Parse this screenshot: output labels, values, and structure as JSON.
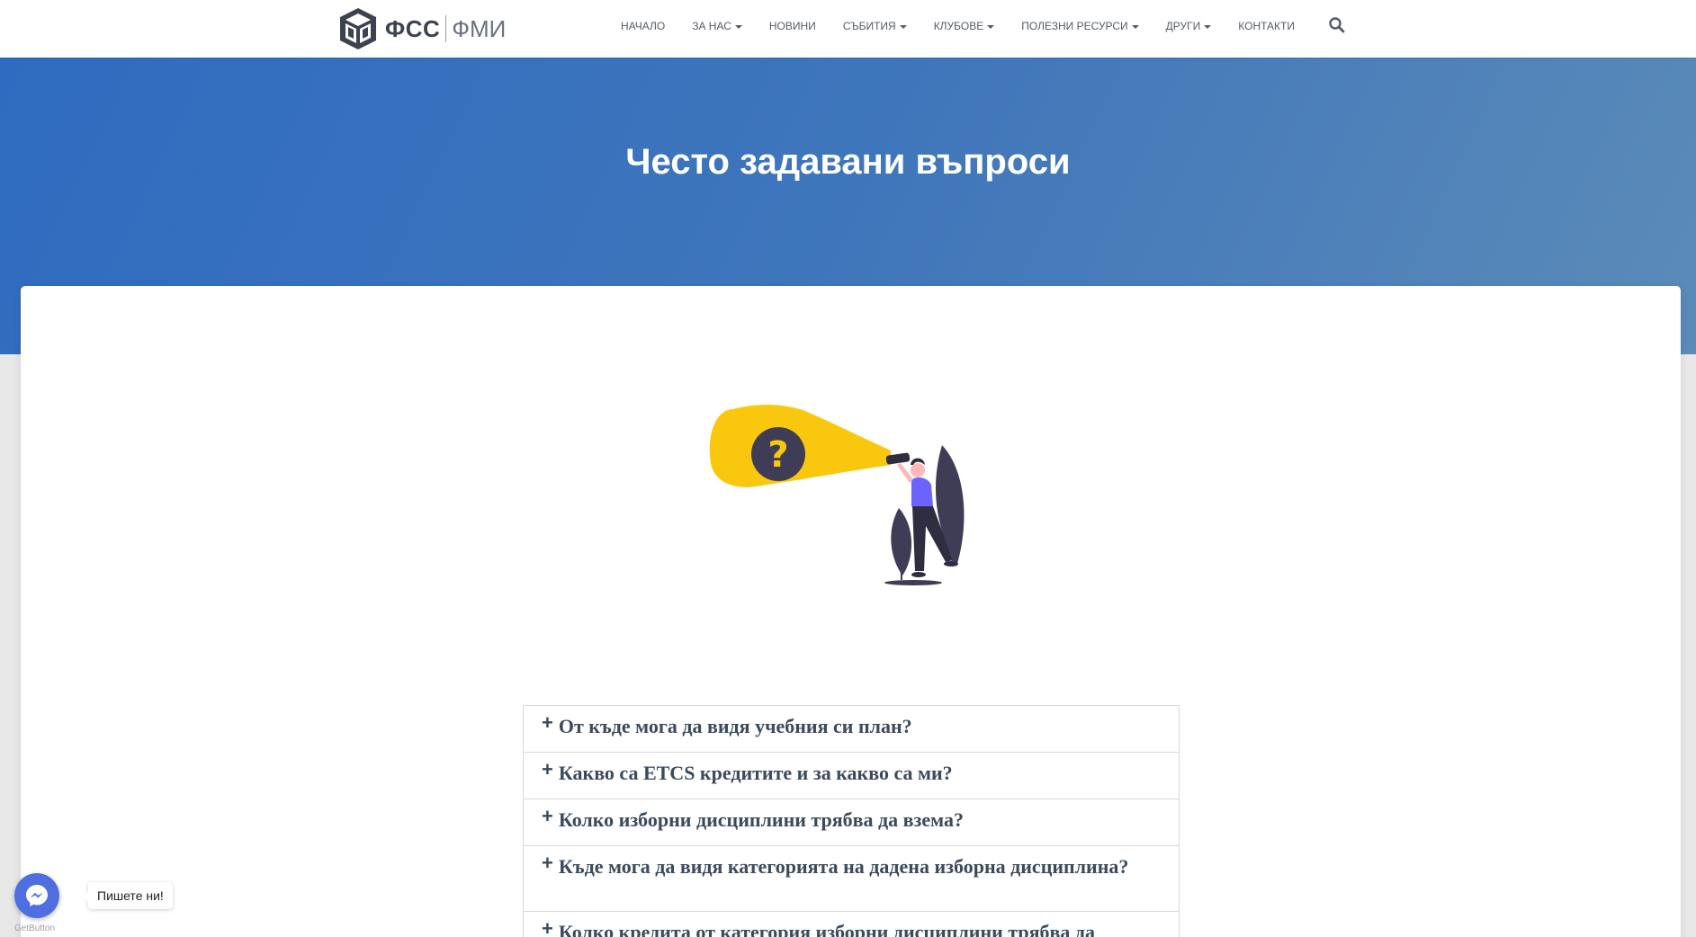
{
  "brand": {
    "main": "ФСС",
    "sub": "ФМИ"
  },
  "nav": {
    "items": [
      {
        "label": "НАЧАЛО",
        "dropdown": false
      },
      {
        "label": "ЗА НАС",
        "dropdown": true
      },
      {
        "label": "НОВИНИ",
        "dropdown": false
      },
      {
        "label": "СЪБИТИЯ",
        "dropdown": true
      },
      {
        "label": "КЛУБОВЕ",
        "dropdown": true
      },
      {
        "label": "ПОЛЕЗНИ РЕСУРСИ",
        "dropdown": true
      },
      {
        "label": "ДРУГИ",
        "dropdown": true
      },
      {
        "label": "КОНТАКТИ",
        "dropdown": false
      }
    ],
    "search_icon": "search-icon"
  },
  "hero": {
    "title": "Често задавани въпроси"
  },
  "faq": {
    "items": [
      "От къде мога да видя учебния си план?",
      "Какво са ETCS кредитите и за какво са ми?",
      "Колко изборни дисциплини трябва да взема?",
      "Къде мога да видя категорията на дадена изборна дисциплина?",
      "Колко кредита от категория изборни дисциплини трябва да"
    ]
  },
  "chat": {
    "tooltip": "Пишете ни!",
    "provider": "GetButton"
  },
  "colors": {
    "hero_start": "#2f6bc0",
    "hero_end": "#5b8bb8",
    "accent_yellow": "#f9c80e",
    "purple": "#3f3d56",
    "messenger": "#4f6fe0"
  }
}
